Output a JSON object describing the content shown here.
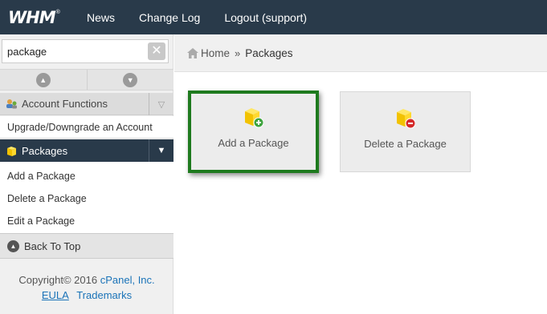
{
  "header": {
    "logo": "WHM",
    "logo_tm": "®",
    "nav": [
      "News",
      "Change Log",
      "Logout (support)"
    ]
  },
  "sidebar": {
    "search": {
      "value": "package",
      "placeholder": ""
    },
    "categories": [
      {
        "label": "Account Functions",
        "icon": "account-functions-icon",
        "expanded": false,
        "items": [
          "Upgrade/Downgrade an Account"
        ]
      },
      {
        "label": "Packages",
        "icon": "packages-icon",
        "expanded": true,
        "items": [
          "Add a Package",
          "Delete a Package",
          "Edit a Package"
        ]
      }
    ],
    "back_to_top": "Back To Top",
    "footer": {
      "copyright": "Copyright© 2016",
      "company": "cPanel, Inc.",
      "eula": "EULA",
      "trademarks": "Trademarks"
    }
  },
  "breadcrumb": {
    "home": "Home",
    "separator": "»",
    "current": "Packages"
  },
  "tiles": [
    {
      "label": "Add a Package",
      "icon": "package-add-icon",
      "selected": true
    },
    {
      "label": "Delete a Package",
      "icon": "package-delete-icon",
      "selected": false
    }
  ],
  "colors": {
    "topbar": "#293a4a",
    "highlight": "#1e7a1e",
    "link": "#1a73b8"
  }
}
